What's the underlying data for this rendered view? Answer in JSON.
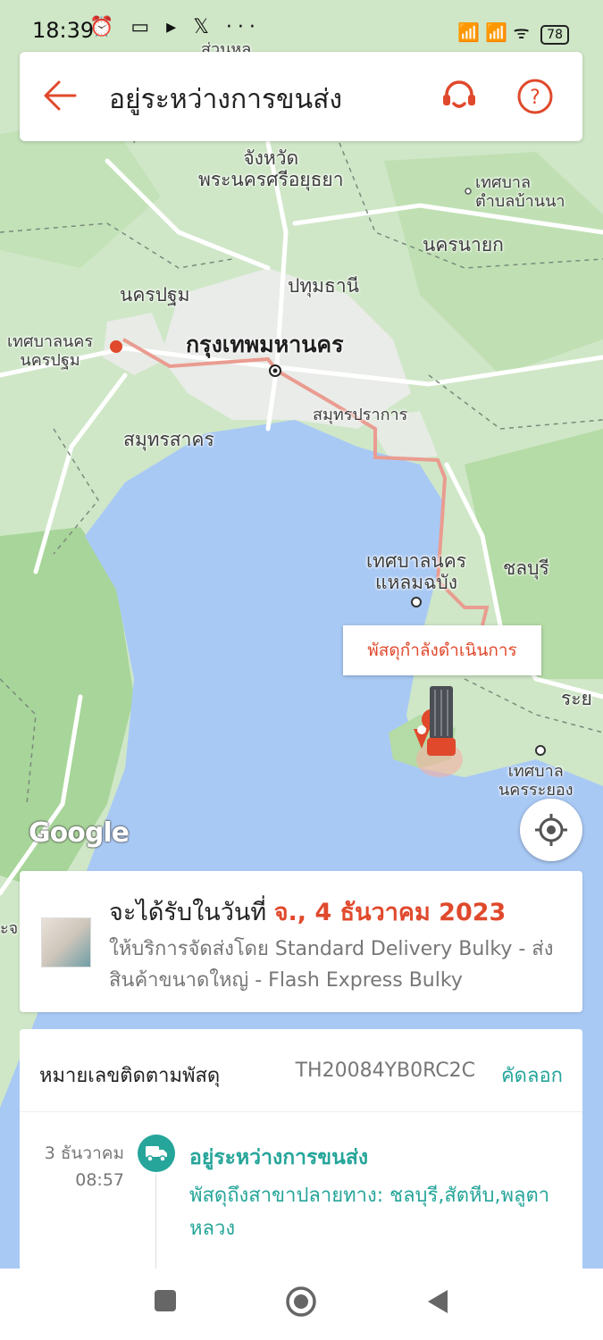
{
  "status_bar": {
    "time": "18:39",
    "left_icons": "⏰ ▭ ▸ 𝕏 ···",
    "right_icons": "📶 📶 ᯤ",
    "battery": "78"
  },
  "header": {
    "title": "อยู่ระหว่างการขนส่ง",
    "back_icon": "arrow-left-icon",
    "support_icon": "headset-icon",
    "help_icon": "question-icon",
    "accent": "#e0492c"
  },
  "map": {
    "labels": {
      "province_ayutthaya": "จังหวัด\nพระนครศรีอยุธยา",
      "tambon_ban_na": "เทศบาล\nตำบลบ้านนา",
      "nakhon_nayok": "นครนายก",
      "nakhon_pathom": "นครปฐม",
      "pathum_thani": "ปทุมธานี",
      "nakhon_pathom_city": "เทศบาลนคร\nนครปฐม",
      "bangkok": "กรุงเทพมหานคร",
      "samut_prakan": "สมุทรปราการ",
      "samut_sakhon": "สมุทรสาคร",
      "laem_chabang": "เทศบาลนคร\nแหลมฉบัง",
      "chonburi": "ชลบุรี",
      "rayong_edge": "ระย",
      "rayong_city": "เทศบาล\nนครระยอง",
      "top_cut": "ส่วนหล",
      "left_edge": "ะจ"
    },
    "popup_text": "พัสดุกำลังดำเนินการ",
    "google_logo": "Google",
    "locate_icon": "crosshair-icon"
  },
  "delivery_card": {
    "prefix": "จะได้รับในวันที่ ",
    "date": "จ., 4 ธันวาคม 2023",
    "service": "ให้บริการจัดส่งโดย Standard Delivery Bulky - ส่งสินค้าขนาดใหญ่ - Flash Express Bulky"
  },
  "tracking": {
    "label": "หมายเลขติดตามพัสดุ",
    "number": "TH20084YB0RC2C",
    "copy": "คัดลอก",
    "accent": "#26a59a",
    "events": [
      {
        "date": "3 ธันวาคม",
        "time": "08:57",
        "title": "อยู่ระหว่างการขนส่ง",
        "description": "พัสดุถึงสาขาปลายทาง: ชลบุรี,สัตหีบ,พลูตาหลวง",
        "icon": "truck-icon"
      }
    ]
  },
  "nav_bar": {
    "recent_icon": "square-icon",
    "home_icon": "circle-icon",
    "back_icon": "triangle-back-icon"
  }
}
